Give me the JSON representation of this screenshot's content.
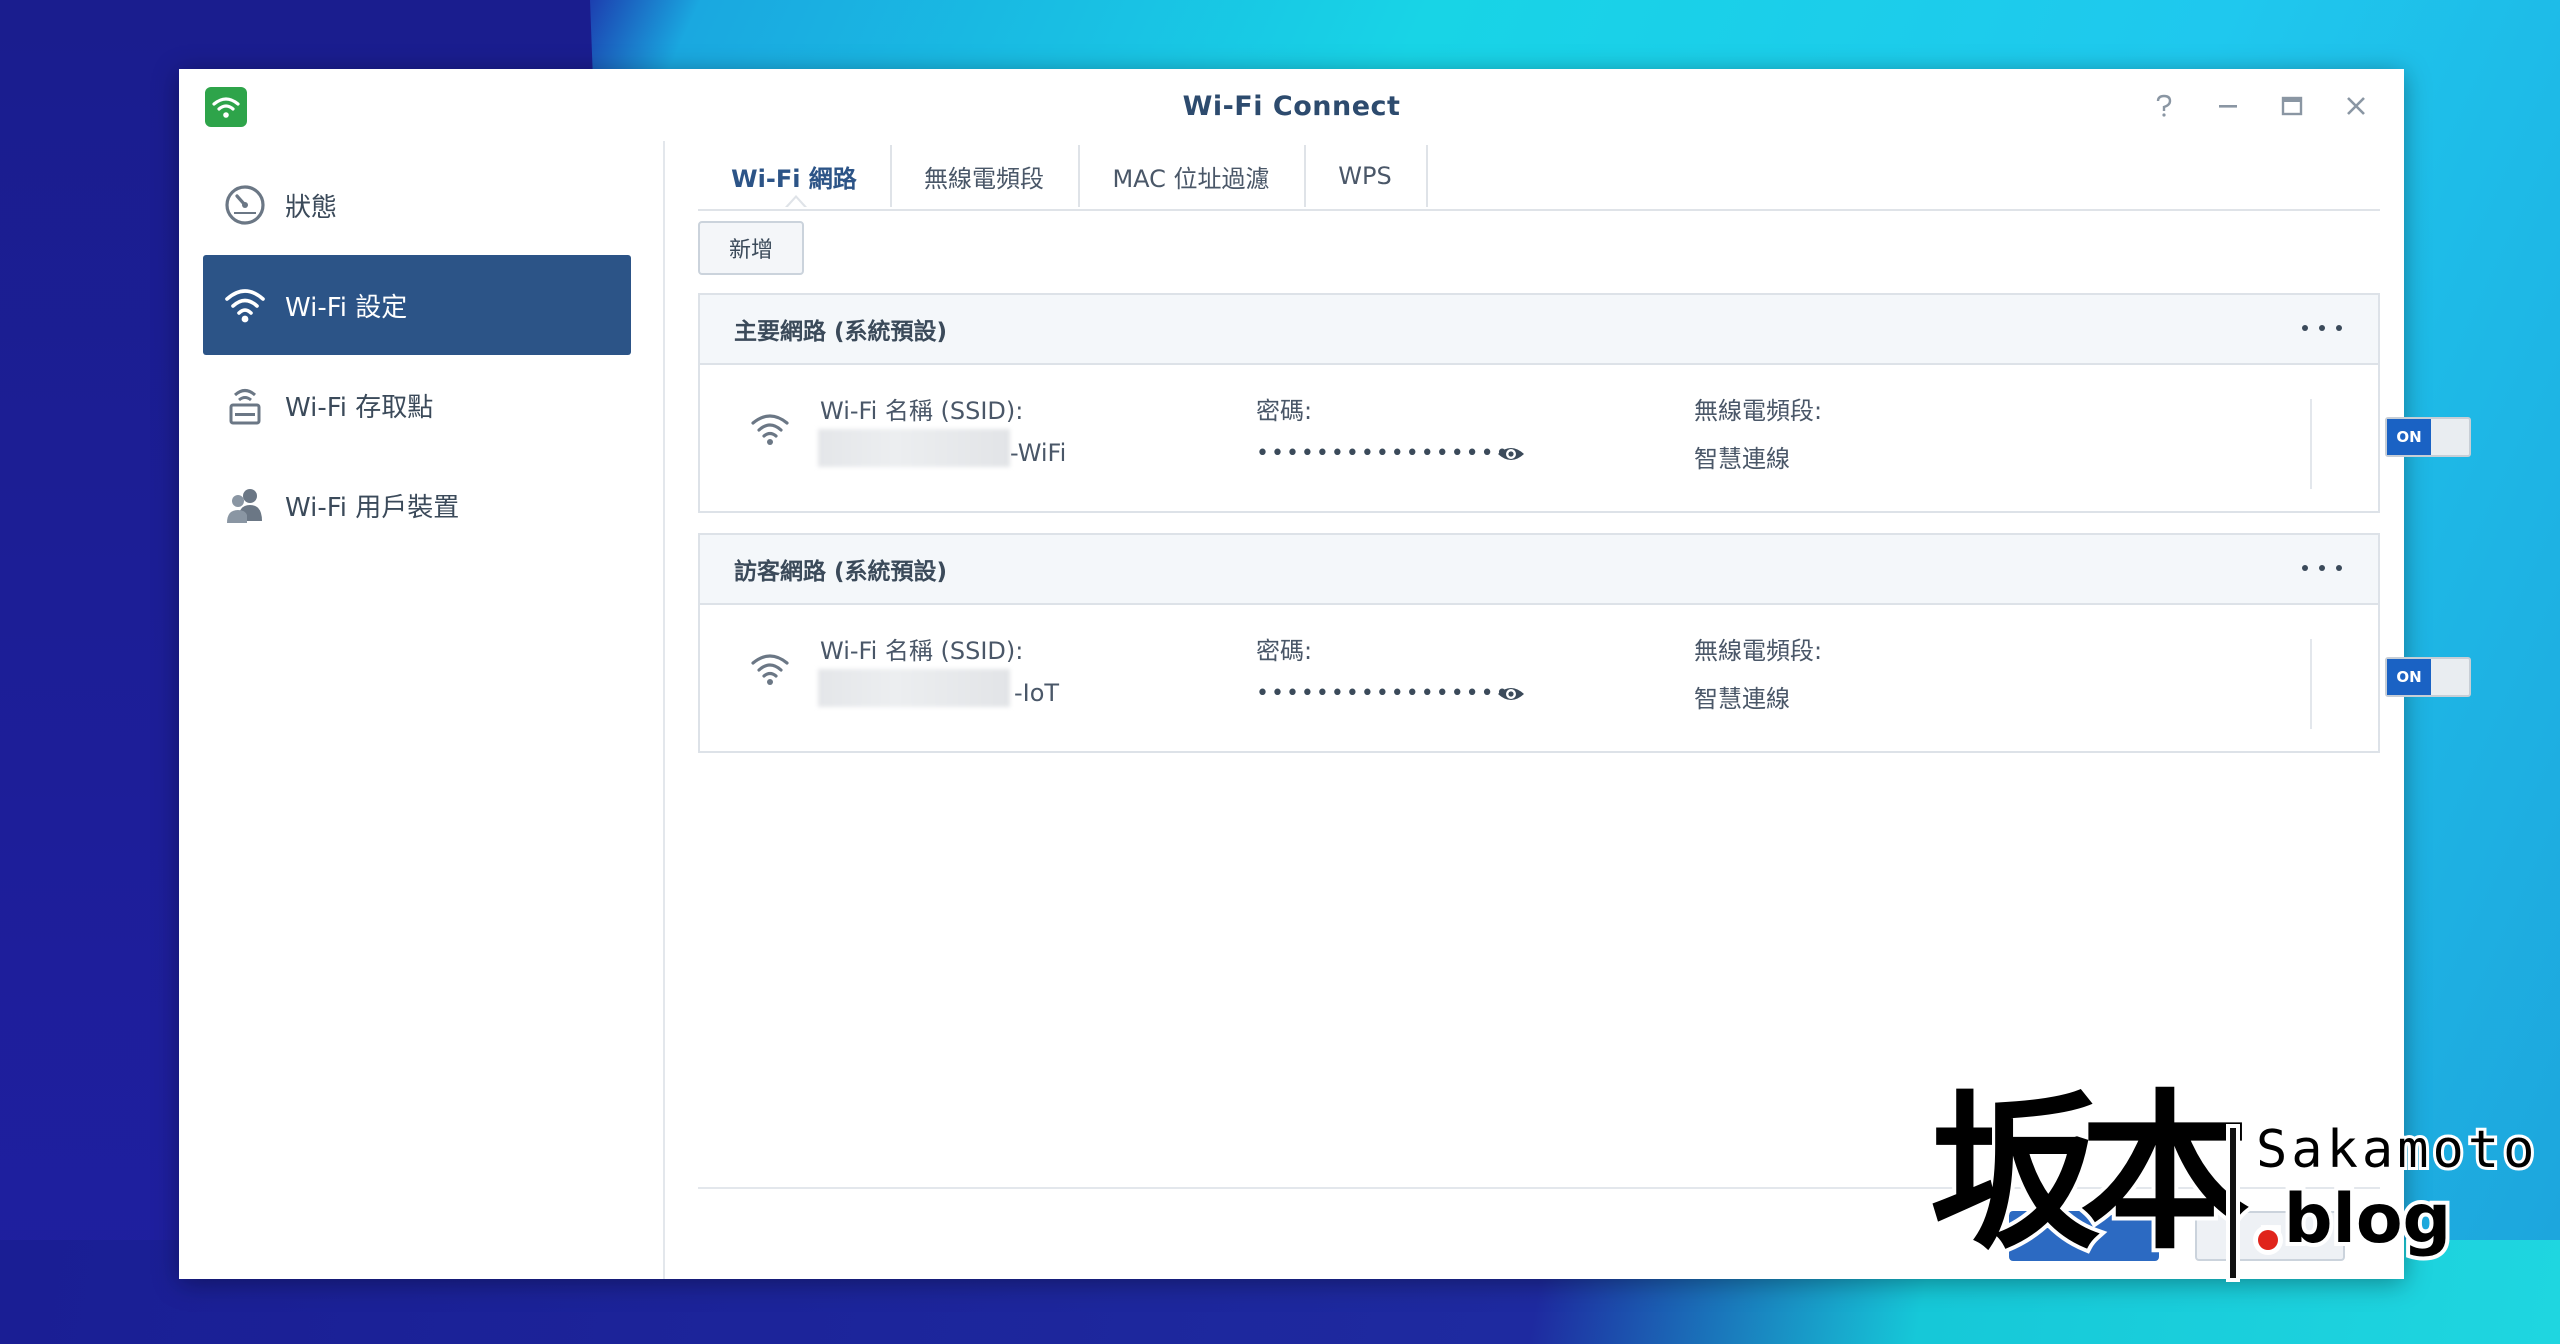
{
  "window": {
    "title": "Wi-Fi Connect"
  },
  "sidebar": {
    "items": [
      {
        "label": "狀態",
        "icon": "gauge-icon",
        "active": false
      },
      {
        "label": "Wi-Fi 設定",
        "icon": "wifi-icon",
        "active": true
      },
      {
        "label": "Wi-Fi 存取點",
        "icon": "router-icon",
        "active": false
      },
      {
        "label": "Wi-Fi 用戶裝置",
        "icon": "users-icon",
        "active": false
      }
    ]
  },
  "tabs": [
    {
      "label": "Wi-Fi 網路",
      "active": true
    },
    {
      "label": "無線電頻段",
      "active": false
    },
    {
      "label": "MAC 位址過濾",
      "active": false
    },
    {
      "label": "WPS",
      "active": false
    }
  ],
  "toolbar": {
    "add_label": "新增"
  },
  "networks": [
    {
      "title": "主要網路 (系統預設)",
      "ssid_label": "Wi-Fi 名稱 (SSID):",
      "ssid_suffix": "-WiFi",
      "password_label": "密碼:",
      "password_mask": "•••••••••••••••••",
      "band_label": "無線電頻段:",
      "band_value": "智慧連線",
      "toggle_label": "ON"
    },
    {
      "title": "訪客網路 (系統預設)",
      "ssid_label": "Wi-Fi 名稱 (SSID):",
      "ssid_suffix": "-IoT",
      "password_label": "密碼:",
      "password_mask": "•••••••••••••••••",
      "band_label": "無線電頻段:",
      "band_value": "智慧連線",
      "toggle_label": "ON"
    }
  ],
  "watermark": {
    "kanji": "坂本",
    "name": "Sakamoto",
    "domain": ".blog"
  },
  "colors": {
    "accent": "#2c5487",
    "toggle_on": "#1a62c4",
    "logo_green": "#2ea44a"
  }
}
